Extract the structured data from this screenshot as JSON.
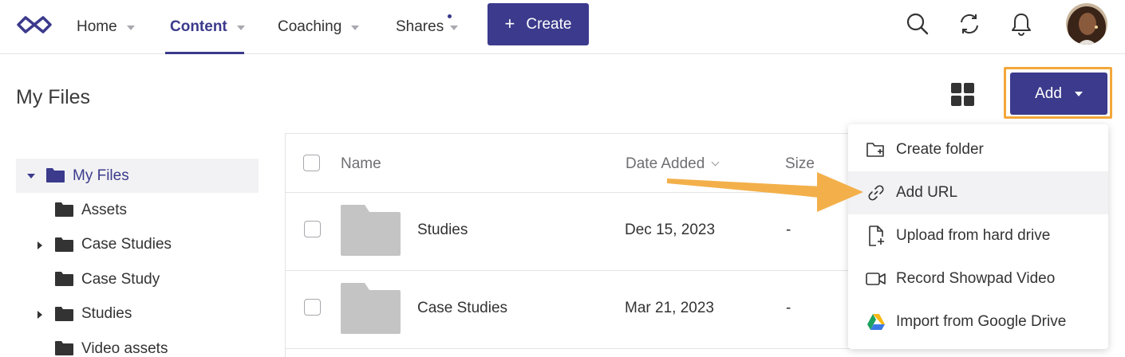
{
  "nav": {
    "items": [
      {
        "label": "Home"
      },
      {
        "label": "Content"
      },
      {
        "label": "Coaching"
      },
      {
        "label": "Shares"
      }
    ],
    "create_label": "Create"
  },
  "header": {
    "title": "My Files",
    "add_label": "Add"
  },
  "tree": {
    "items": [
      {
        "label": "My Files"
      },
      {
        "label": "Assets"
      },
      {
        "label": "Case Studies"
      },
      {
        "label": "Case Study"
      },
      {
        "label": "Studies"
      },
      {
        "label": "Video assets"
      }
    ]
  },
  "table": {
    "columns": {
      "name": "Name",
      "date": "Date Added",
      "size": "Size"
    },
    "rows": [
      {
        "name": "Studies",
        "date": "Dec 15, 2023",
        "size": "-"
      },
      {
        "name": "Case Studies",
        "date": "Mar 21, 2023",
        "size": "-"
      }
    ]
  },
  "menu": {
    "items": [
      {
        "label": "Create folder",
        "icon": "folder-plus-icon"
      },
      {
        "label": "Add URL",
        "icon": "link-icon"
      },
      {
        "label": "Upload from hard drive",
        "icon": "file-upload-icon"
      },
      {
        "label": "Record Showpad Video",
        "icon": "video-camera-icon"
      },
      {
        "label": "Import from Google Drive",
        "icon": "google-drive-icon"
      }
    ]
  },
  "colors": {
    "brand": "#3b3a8c",
    "highlight": "#f3a73a"
  }
}
